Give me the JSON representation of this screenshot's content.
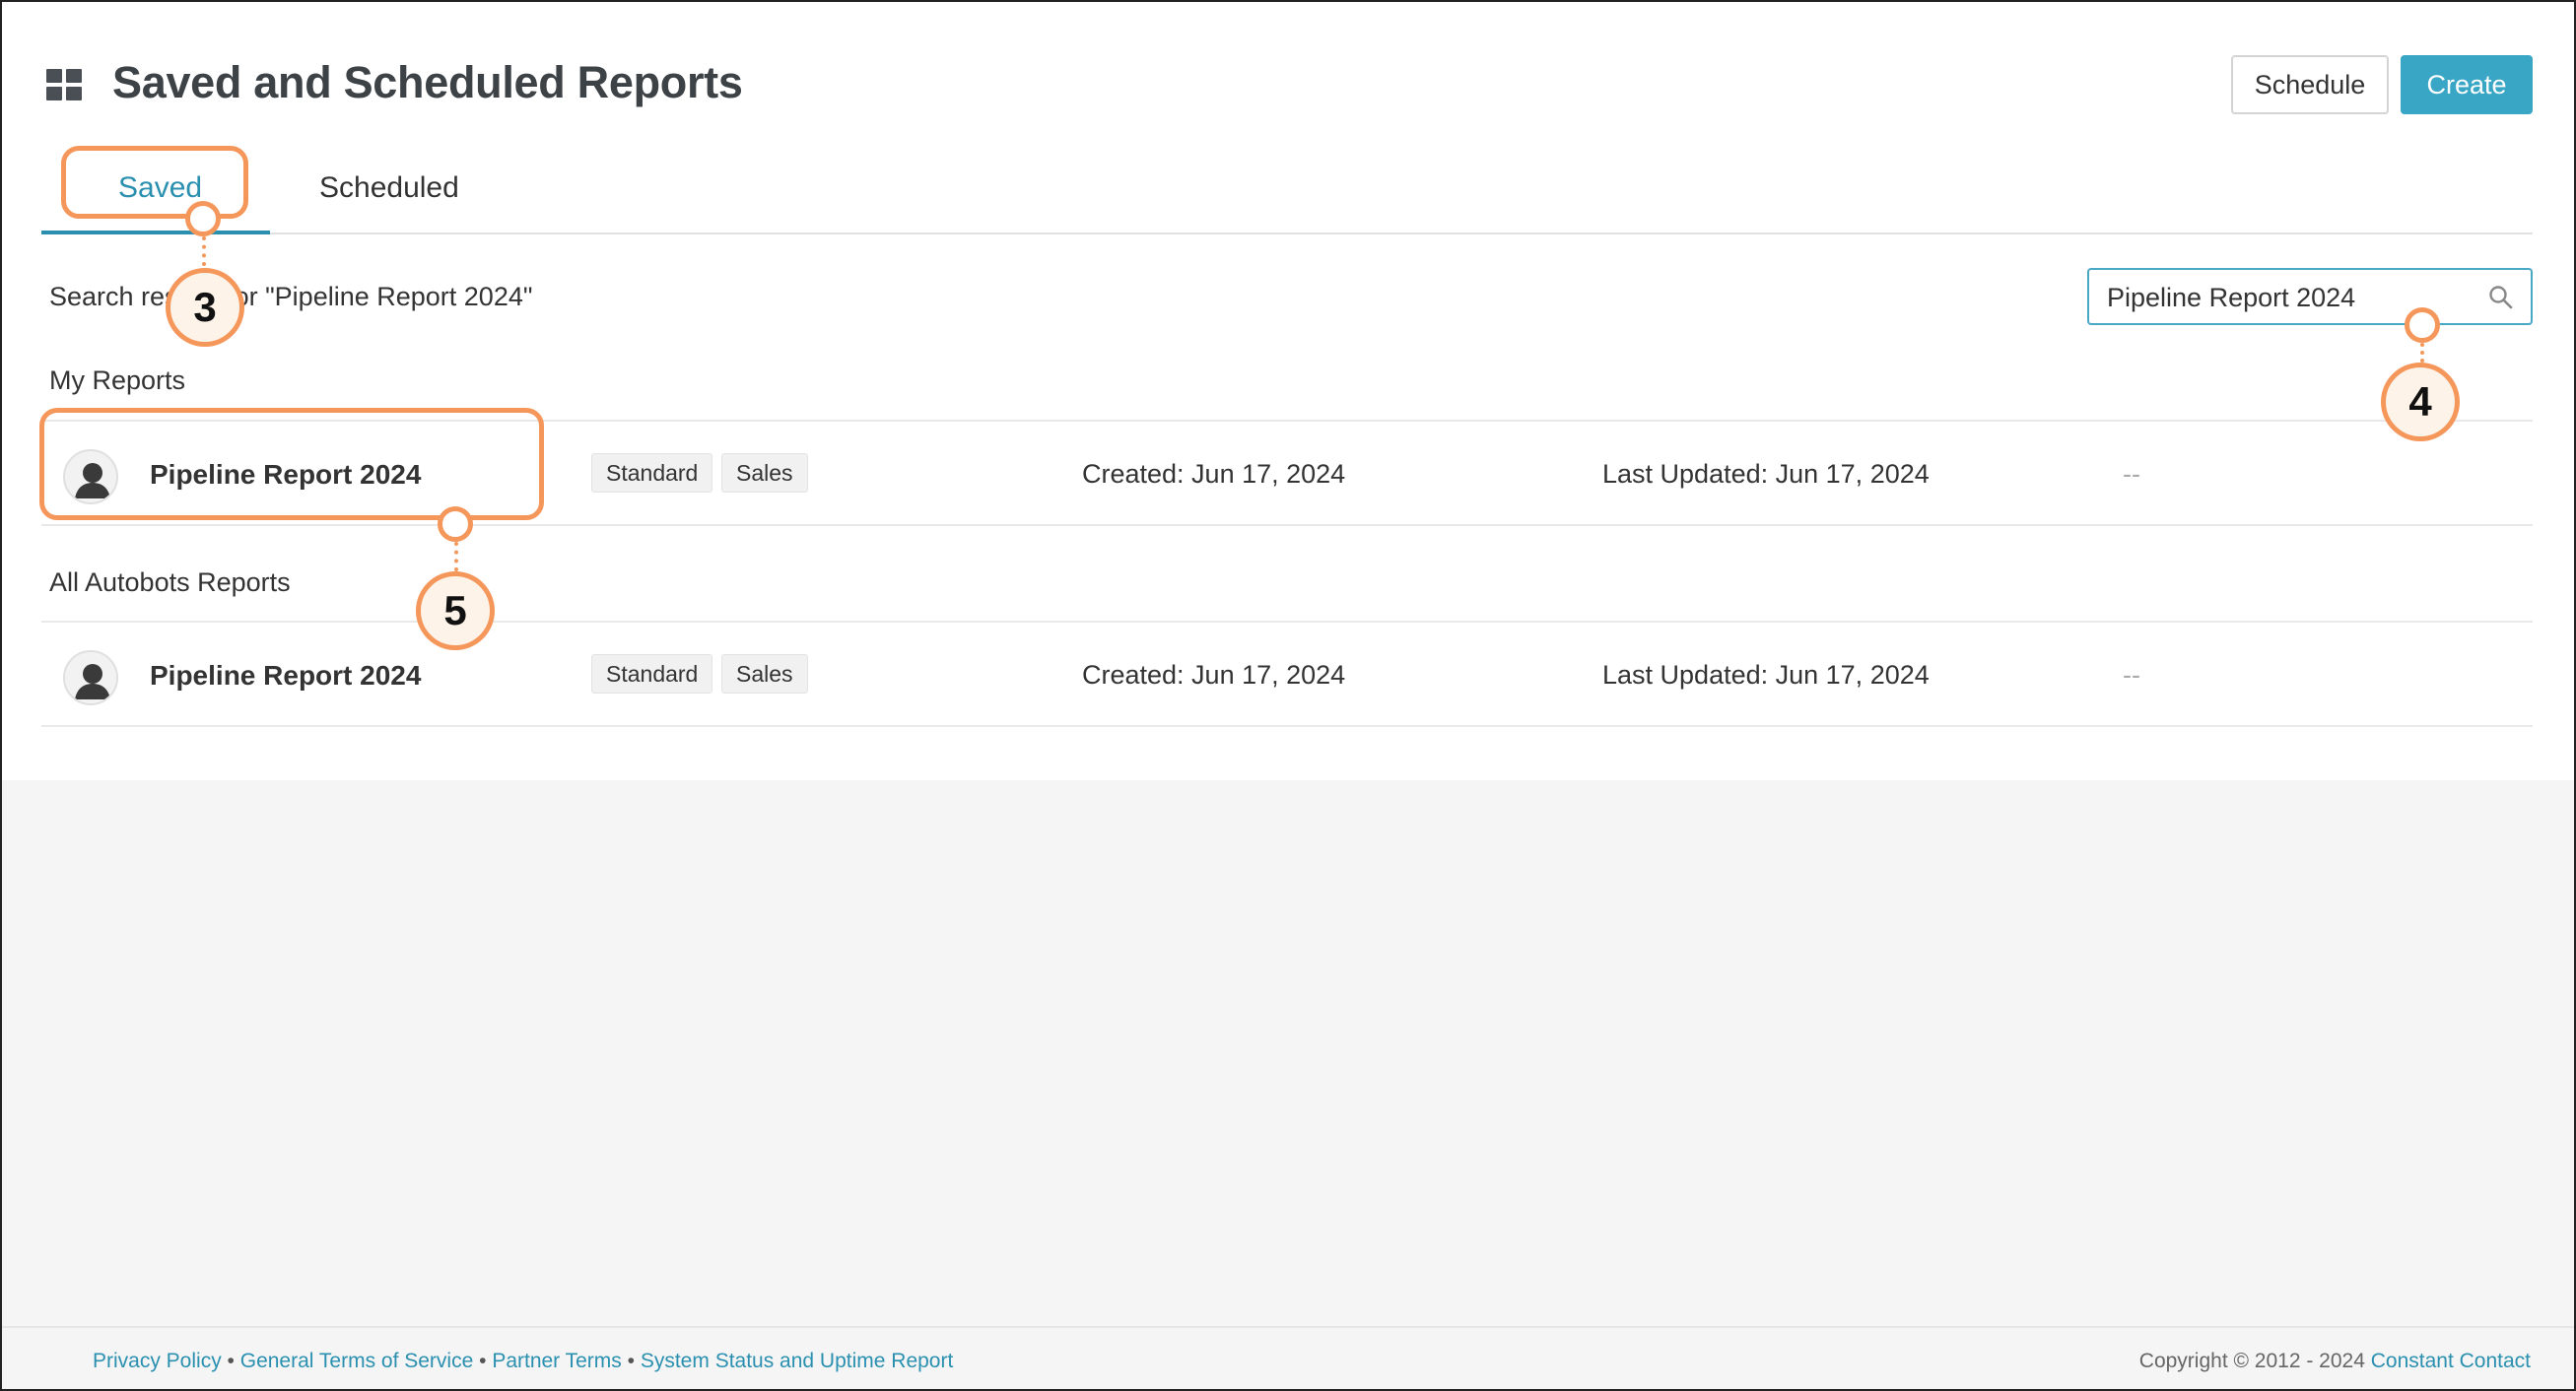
{
  "header": {
    "title": "Saved and Scheduled Reports",
    "schedule_label": "Schedule",
    "create_label": "Create"
  },
  "tabs": [
    {
      "label": "Saved",
      "active": true
    },
    {
      "label": "Scheduled",
      "active": false
    }
  ],
  "search": {
    "results_text": "Search results for \"Pipeline Report 2024\"",
    "value": "Pipeline Report 2024"
  },
  "sections": [
    {
      "label": "My Reports",
      "rows": [
        {
          "name": "Pipeline Report 2024",
          "tags": [
            "Standard",
            "Sales"
          ],
          "created": "Created: Jun 17, 2024",
          "updated": "Last Updated: Jun 17, 2024",
          "extra": "--"
        }
      ]
    },
    {
      "label": "All Autobots Reports",
      "rows": [
        {
          "name": "Pipeline Report 2024",
          "tags": [
            "Standard",
            "Sales"
          ],
          "created": "Created: Jun 17, 2024",
          "updated": "Last Updated: Jun 17, 2024",
          "extra": "--"
        }
      ]
    }
  ],
  "annotations": {
    "badge_3": "3",
    "badge_4": "4",
    "badge_5": "5"
  },
  "footer": {
    "links": [
      "Privacy Policy",
      "General Terms of Service",
      "Partner Terms",
      "System Status and Uptime Report"
    ],
    "separator": " • ",
    "copyright": "Copyright © 2012 - 2024 ",
    "brand": "Constant Contact"
  },
  "colors": {
    "accent": "#2b90b0",
    "create_button": "#3aa6c6",
    "annotation": "#f5975a"
  }
}
